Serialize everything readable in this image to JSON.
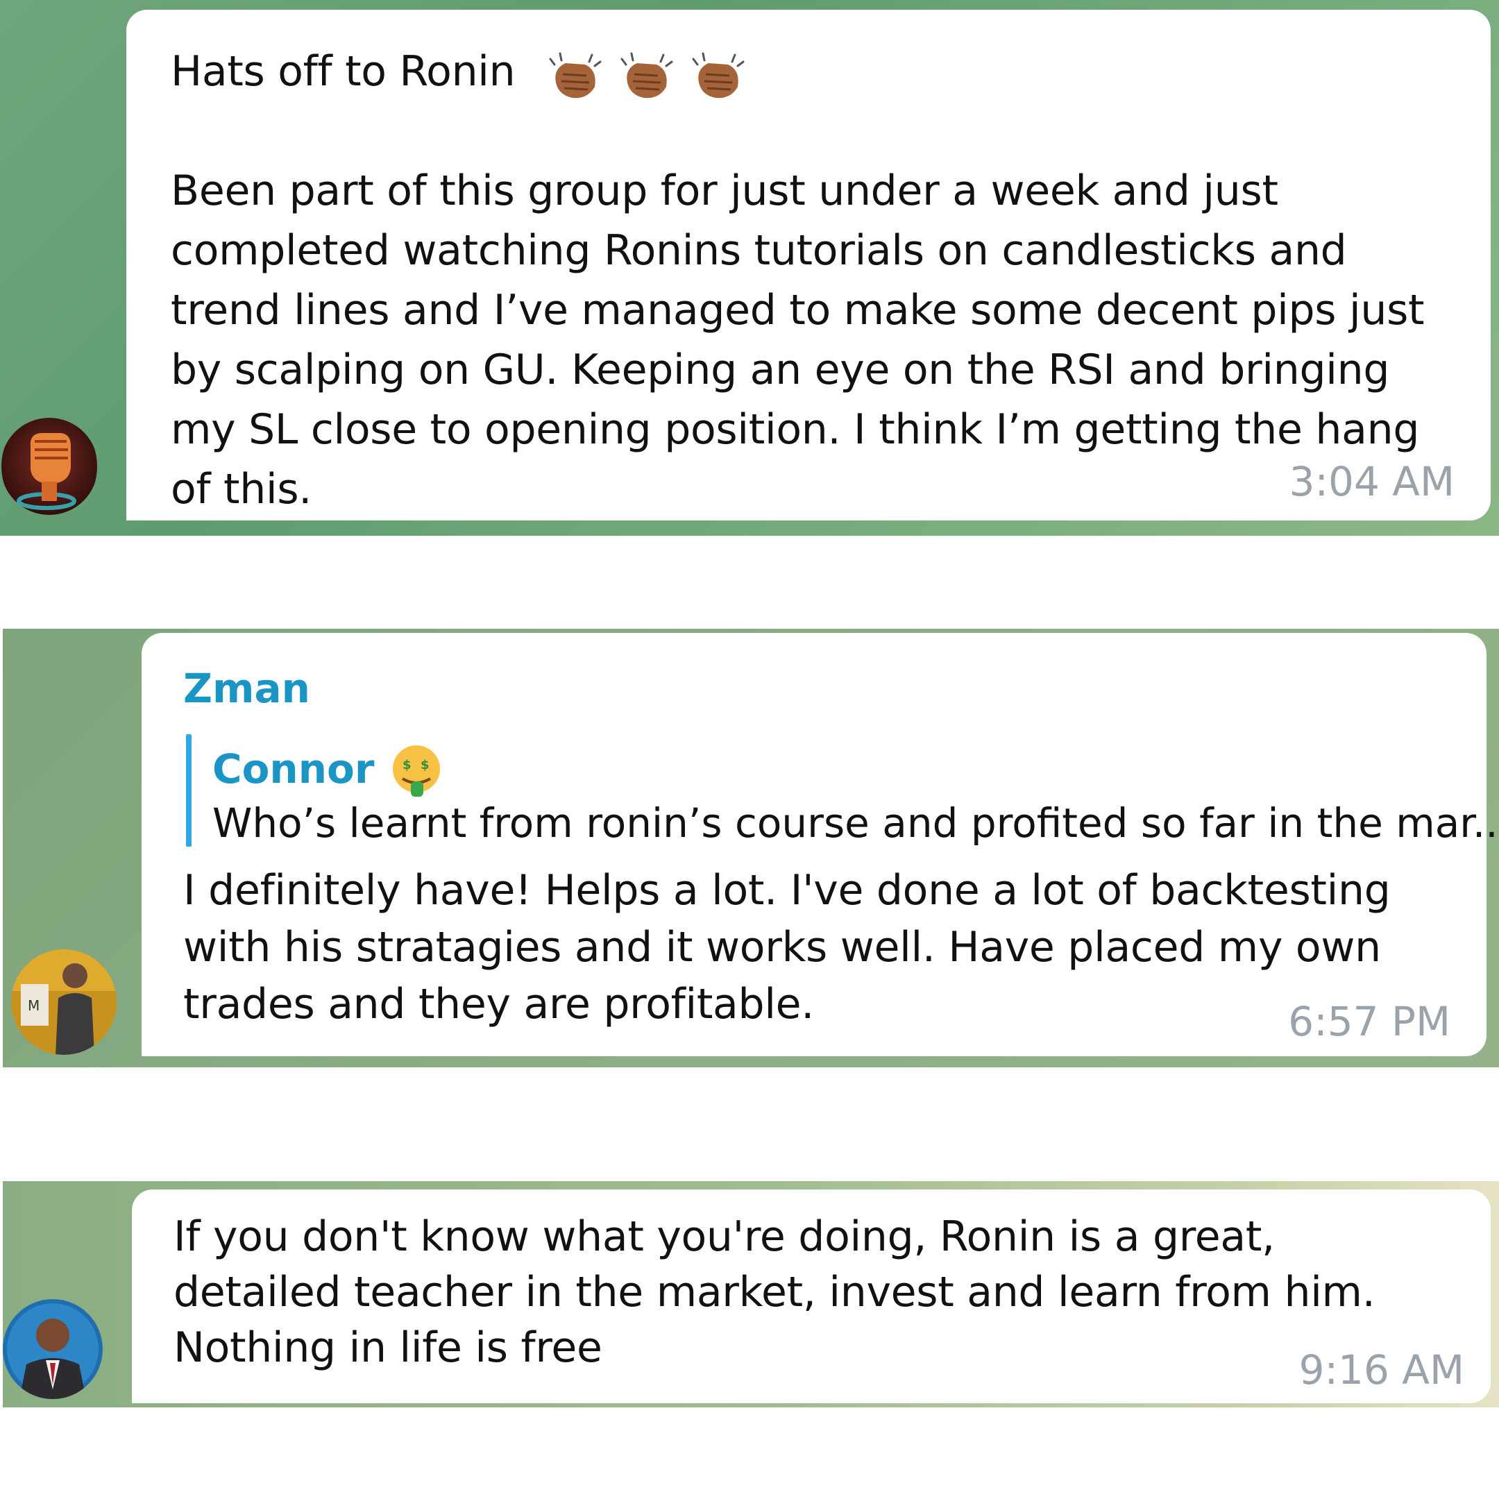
{
  "messages": [
    {
      "title": "Hats off to Ronin",
      "reaction_emoji": [
        "clapping-hands",
        "clapping-hands",
        "clapping-hands"
      ],
      "body": "Been part of this group for just under a week and just completed watching Ronins tutorials on candlesticks and trend lines and I’ve managed to make some decent pips just by scalping on GU. Keeping an eye on the RSI and bringing my SL close to opening position. I think I’m getting the hang of this.",
      "time": "3:04 AM",
      "avatar_icon": "raised-fist-avatar"
    },
    {
      "sender": "Zman",
      "reply": {
        "name": "Connor",
        "name_emoji": "money-mouth-face",
        "text": "Who’s learnt from ronin’s course and profited so far in the mar..."
      },
      "body": "I definitely have! Helps a lot. I've done a lot of backtesting with his stratagies and it works well. Have placed my own trades and they are profitable.",
      "time": "6:57 PM",
      "avatar_icon": "person-photo-avatar"
    },
    {
      "body": "If you don't know what you're doing, Ronin is a great, detailed teacher in the market, invest and learn from him. Nothing in life is free",
      "time": "9:16 AM",
      "avatar_icon": "man-in-suit-avatar"
    }
  ],
  "colors": {
    "accent_name": "#1a95c5",
    "quote_bar": "#2ea8e4",
    "timestamp": "#9aa3ab"
  }
}
